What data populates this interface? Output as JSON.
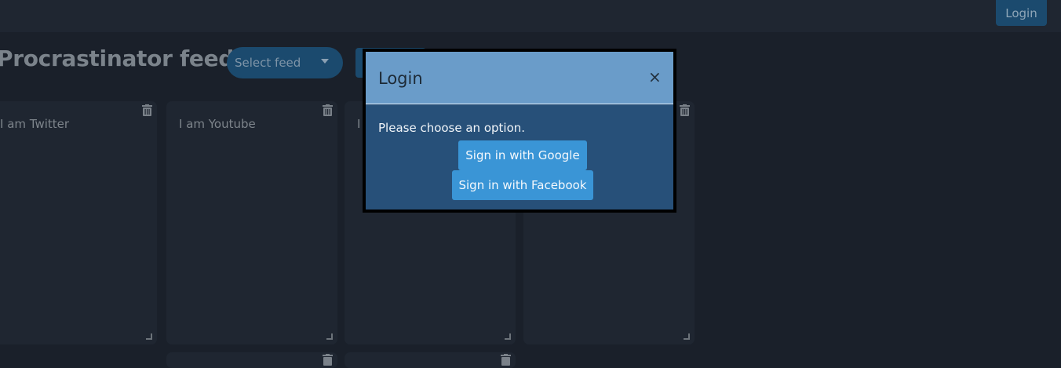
{
  "navbar": {
    "login_label": "Login"
  },
  "main": {
    "title": "Procrastinator feeds",
    "select_feed_placeholder": "Select feed"
  },
  "cards": [
    {
      "label": "I am Twitter"
    },
    {
      "label": "I am Youtube"
    },
    {
      "label": "I"
    },
    {
      "label": ""
    }
  ],
  "modal": {
    "title": "Login",
    "close_symbol": "×",
    "prompt": "Please choose an option.",
    "google_label": "Sign in with Google",
    "facebook_label": "Sign in with Facebook"
  },
  "colors": {
    "background": "#1a202a",
    "accent": "#3a95d6",
    "modal_header": "#6a9cc9",
    "modal_body": "#275079"
  }
}
